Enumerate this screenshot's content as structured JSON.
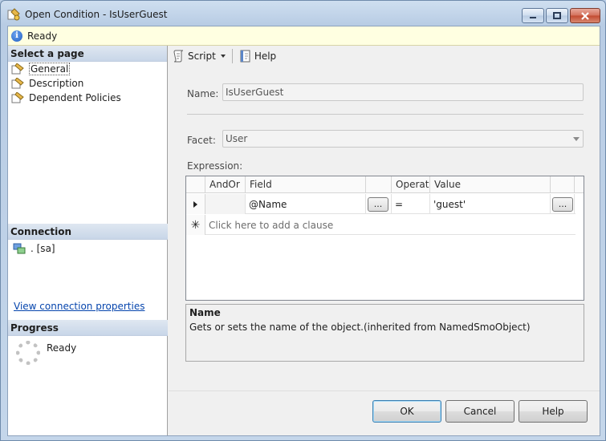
{
  "window": {
    "title": "Open Condition - IsUserGuest",
    "icon": "condition-icon"
  },
  "status": {
    "icon": "info-icon",
    "text": "Ready"
  },
  "left": {
    "select_page_header": "Select a page",
    "pages": [
      {
        "label": "General",
        "icon": "page-icon",
        "selected": true
      },
      {
        "label": "Description",
        "icon": "page-icon",
        "selected": false
      },
      {
        "label": "Dependent Policies",
        "icon": "page-icon",
        "selected": false
      }
    ],
    "connection_header": "Connection",
    "connection_item": ". [sa]",
    "connection_link": "View connection properties",
    "progress_header": "Progress",
    "progress_status": "Ready"
  },
  "toolbar": {
    "script_label": "Script",
    "help_label": "Help"
  },
  "form": {
    "name_label": "Name:",
    "name_value": "IsUserGuest",
    "facet_label": "Facet:",
    "facet_value": "User",
    "expression_label": "Expression:"
  },
  "grid": {
    "columns": [
      "AndOr",
      "Field",
      "",
      "Operator",
      "Value",
      ""
    ],
    "rows": [
      {
        "andor": "",
        "field": "@Name",
        "operator": "=",
        "value": "'guest'"
      }
    ],
    "add_row_text": "Click here to add a clause",
    "ellipsis": "..."
  },
  "description": {
    "title": "Name",
    "text": "Gets or sets the name of the object.(inherited from NamedSmoObject)"
  },
  "footer": {
    "ok_label": "OK",
    "cancel_label": "Cancel",
    "help_label": "Help"
  }
}
